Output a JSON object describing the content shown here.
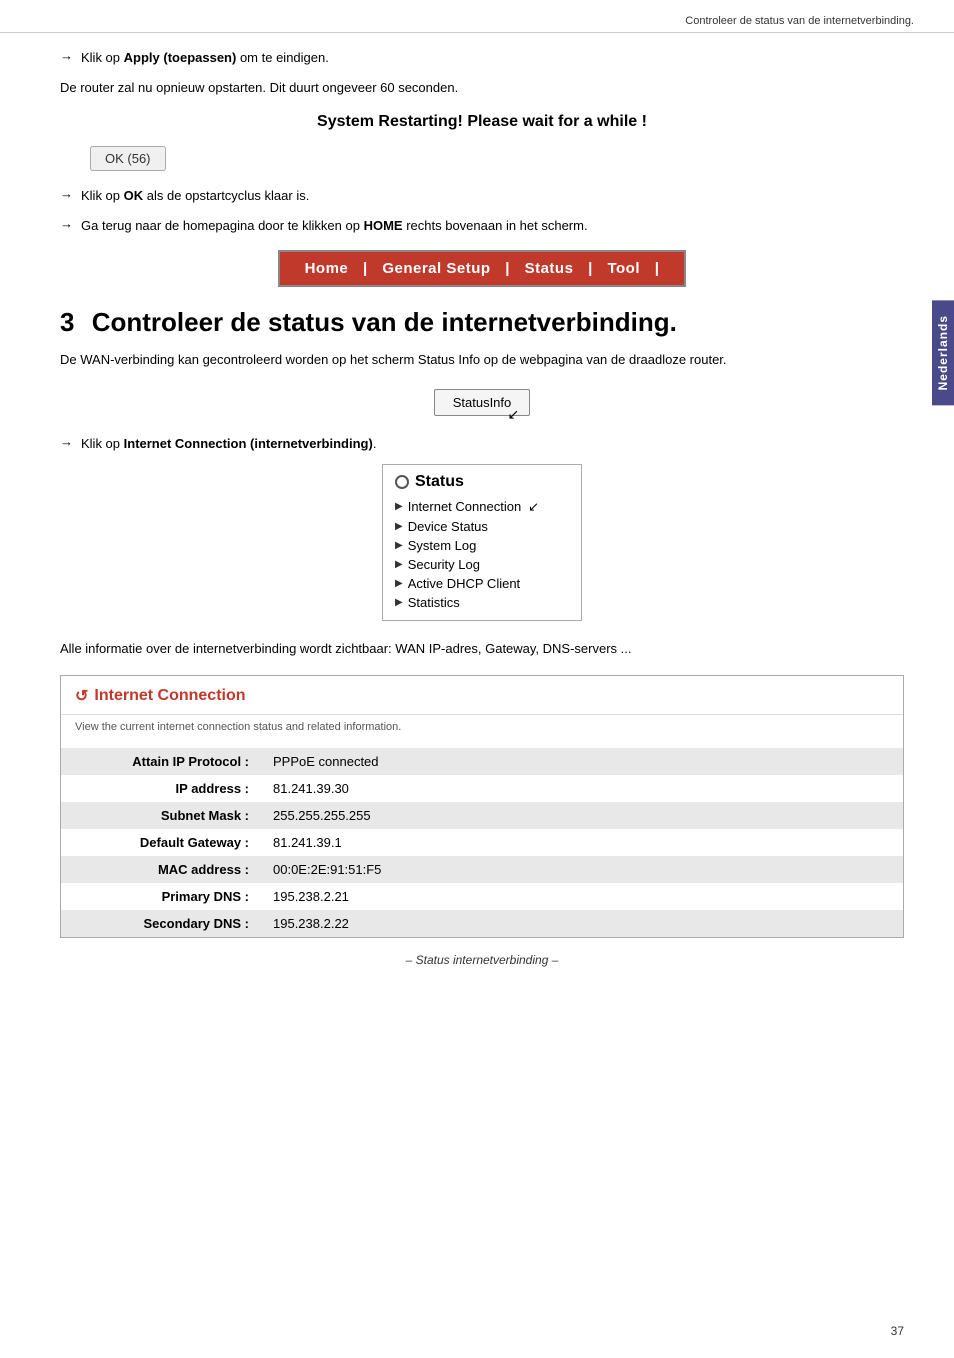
{
  "header": {
    "text": "Controleer de status van de internetverbinding."
  },
  "side_tab": {
    "label": "Nederlands"
  },
  "content": {
    "arrow1": {
      "arrow": "→",
      "text_before": "Klik op ",
      "bold": "Apply (toepassen)",
      "text_after": " om te eindigen."
    },
    "para1": "De router zal nu opnieuw opstarten. Dit duurt ongeveer 60 seconden.",
    "restart_banner": "System Restarting! Please wait for a while !",
    "ok_button": "OK (56)",
    "arrow2": {
      "arrow": "→",
      "text_before": "Klik op ",
      "bold": "OK",
      "text_after": " als de opstartcyclus klaar is."
    },
    "arrow3": {
      "arrow": "→",
      "text_before": "Ga terug naar de homepagina door te klikken op ",
      "bold": "HOME",
      "text_after": " rechts bovenaan in het scherm."
    },
    "navbar": {
      "items": [
        "Home",
        "General Setup",
        "Status",
        "Tool"
      ]
    },
    "section": {
      "number": "3",
      "title": "Controleer de status van de internetverbinding."
    },
    "para2": "De WAN-verbinding kan gecontroleerd worden op het scherm Status Info op de webpagina van de draadloze router.",
    "status_info_button": "StatusInfo",
    "arrow4": {
      "arrow": "→",
      "text_before": "Klik op ",
      "bold": "Internet Connection (internetverbinding)",
      "text_after": "."
    },
    "status_menu": {
      "title": "Status",
      "items": [
        "Internet Connection",
        "Device Status",
        "System Log",
        "Security Log",
        "Active DHCP Client",
        "Statistics"
      ]
    },
    "para3": "Alle informatie over de internetverbinding wordt zichtbaar: WAN IP-adres, Gateway, DNS-servers ...",
    "inet_connection": {
      "title": "Internet Connection",
      "subtitle": "View the current internet connection status and related information.",
      "table": {
        "rows": [
          {
            "label": "Attain IP Protocol :",
            "value": "PPPoE connected"
          },
          {
            "label": "IP address :",
            "value": "81.241.39.30"
          },
          {
            "label": "Subnet Mask :",
            "value": "255.255.255.255"
          },
          {
            "label": "Default Gateway :",
            "value": "81.241.39.1"
          },
          {
            "label": "MAC address :",
            "value": "00:0E:2E:91:51:F5"
          },
          {
            "label": "Primary DNS :",
            "value": "195.238.2.21"
          },
          {
            "label": "Secondary DNS :",
            "value": "195.238.2.22"
          }
        ]
      }
    },
    "caption": "– Status internetverbinding –"
  },
  "page_number": "37"
}
